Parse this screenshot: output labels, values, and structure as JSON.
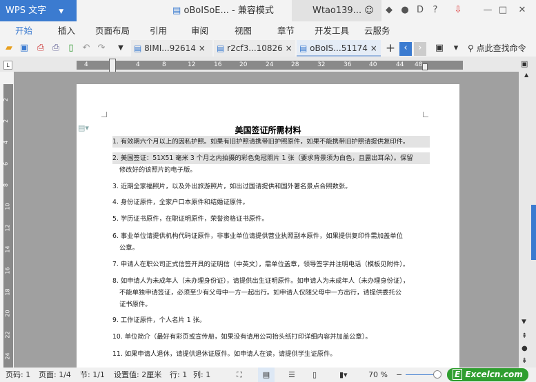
{
  "titlebar": {
    "app": "WPS 文字",
    "doc_title": "oBoISoE... - 兼容模式",
    "user": "Wtao139..."
  },
  "menu": [
    "开始",
    "插入",
    "页面布局",
    "引用",
    "审阅",
    "视图",
    "章节",
    "开发工具",
    "云服务"
  ],
  "tabs": [
    {
      "label": "8IMI...92614"
    },
    {
      "label": "r2cf3...10826"
    },
    {
      "label": "oBoIS...51174"
    }
  ],
  "search": {
    "label": "点此查找命令"
  },
  "ruler": [
    "4",
    "4",
    "8",
    "12",
    "16",
    "20",
    "24",
    "28",
    "32",
    "36",
    "40",
    "44",
    "48"
  ],
  "vruler": [
    "2",
    "2",
    "4",
    "6",
    "8",
    "10",
    "12",
    "14",
    "16",
    "18",
    "20",
    "22",
    "24"
  ],
  "document": {
    "heading": "美国签证所需材料",
    "items": [
      [
        "1. 有效期六个月以上的因私护照。如果有旧护照请携带旧护照原件，如果不能携带旧护照请提供复印件。"
      ],
      [
        "2.  美国签证：51X51 毫米 3 个月之内拍摄的彩色免冠照片 1 张（要求背景须为白色，且露出耳朵）。保留",
        "修改好的该照片的电子版。"
      ],
      [
        "3.  近期全家福照片，以及外出旅游照片，如出过国请提供和国外著名景点合照数张。"
      ],
      [
        "4.  身份证原件，全家户口本原件和结婚证原件。"
      ],
      [
        "5.  学历证书原件，在职证明原件，荣誉资格证书原件。"
      ],
      [
        "6.  事业单位请提供机构代码证原件，非事业单位请提供营业执照副本原件，如果提供复印件需加盖单位",
        "公章。"
      ],
      [
        "7.  申请人在职公司正式信签开具的证明信（中英文），需单位盖章，领导签字并注明电话（模板见附件）。"
      ],
      [
        "8.  如申请人为未成年人（未办理身份证），请提供出生证明原件。如申请人为未成年人（未办理身份证），",
        "不能单独申请签证，必须至少有父母中一方一起出行。如申请人仅随父母中一方出行，请提供委托公",
        "证书原件。"
      ],
      [
        "9.  工作证原件，个人名片 1 张。"
      ],
      [
        "10. 单位简介（最好有彩页或宣传册，如果没有请用公司抬头纸打印详细内容并加盖公章）。"
      ],
      [
        "11. 如果申请人退休，请提供退休证原件。如申请人在读，请提供学生证原件。"
      ]
    ]
  },
  "status": {
    "page": "页码: 1",
    "pages": "页面: 1/4",
    "section": "节: 1/1",
    "setting": "设置值: 2厘米",
    "row": "行: 1",
    "col": "列: 1",
    "zoom": "70 %"
  },
  "watermark": "Excelcn.com",
  "colors": {
    "accent": "#3b7bd0",
    "logo": "#2f9e2f"
  }
}
